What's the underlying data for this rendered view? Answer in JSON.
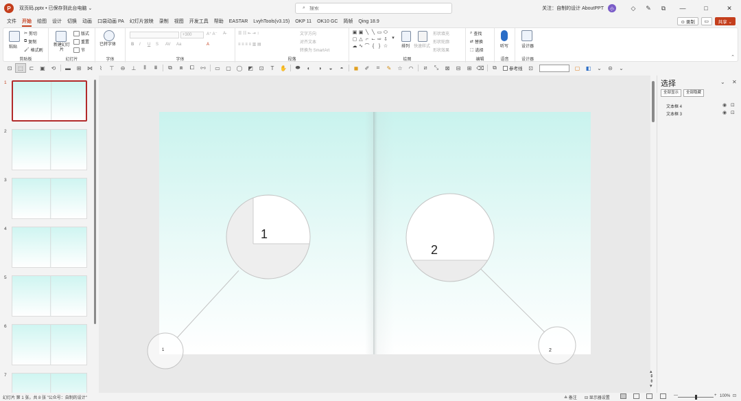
{
  "titlebar": {
    "logo": "P",
    "doc_title": "双页码.pptx • 已保存到此台电脑 ⌄",
    "search_placeholder": "搜索",
    "follow_text": "关注：自制的设计 AboutPPT",
    "avatar": "小",
    "icons": [
      "diamond-icon",
      "pen-icon",
      "restore-icon"
    ],
    "win_minimize": "—",
    "win_maximize": "□",
    "win_close": "✕"
  },
  "menu": {
    "items": [
      "文件",
      "开始",
      "绘图",
      "设计",
      "切换",
      "动画",
      "口袋动画 PA",
      "幻灯片放映",
      "录制",
      "视图",
      "开发工具",
      "帮助",
      "EASTAR",
      "LvyhTools(v3.15)",
      "OKP 11",
      "OK10 GC",
      "简帧",
      "Qing 18.9"
    ],
    "active_index": 1,
    "record_label": "⊙ 录制",
    "comment_label": "▭",
    "share_label": "共享 ⌄"
  },
  "ribbon": {
    "clipboard": {
      "label": "剪贴板",
      "paste": "粘贴",
      "cut": "剪切",
      "copy": "复制",
      "format": "格式刷"
    },
    "slides": {
      "label": "幻灯片",
      "new_slide": "新建幻灯片",
      "layout": "版式",
      "reset": "重置",
      "section": "节"
    },
    "font_group": {
      "label": "字体",
      "convert": "已转字体",
      "font_placeholder": "",
      "size_placeholder": "+300"
    },
    "font": {
      "label": "字体",
      "bold": "B",
      "italic": "I",
      "underline": "U",
      "strike": "S",
      "spacing": "AV",
      "case": "Aa",
      "color": "A"
    },
    "paragraph": {
      "label": "段落",
      "text_direction": "文字方向",
      "align_text": "对齐文本",
      "smartart": "转换为 SmartArt"
    },
    "drawing": {
      "label": "绘图",
      "arrange": "排列",
      "quick_styles": "快速样式",
      "fill": "形状填充",
      "outline": "形状轮廓",
      "effects": "形状效果"
    },
    "editing": {
      "label": "编辑",
      "find": "查找",
      "replace": "替换",
      "select": "选择"
    },
    "voice": {
      "label": "语音",
      "dictate": "听写"
    },
    "designer": {
      "label": "设计器",
      "design": "设计器"
    }
  },
  "toolbar2": {
    "guides_label": "参考线"
  },
  "thumbnails": {
    "numbers": [
      "1",
      "2",
      "3",
      "4",
      "5",
      "6",
      "7"
    ],
    "active_index": 0
  },
  "slide": {
    "magnifiers": [
      {
        "label": "1",
        "small_label": "1"
      },
      {
        "label": "2",
        "small_label": "2"
      }
    ]
  },
  "selection_pane": {
    "title": "选择",
    "show_all": "全部显示",
    "hide_all": "全部隐藏",
    "items": [
      "文本框 4",
      "文本框 3"
    ],
    "eye_icon": "◉",
    "lock_icon": "⊡",
    "collapse_icon": "⌄",
    "close_icon": "✕"
  },
  "statusbar": {
    "slide_info": "幻灯片 第 1 张，共 8 张   \"公众号：自制的设计\"",
    "notes": "≙ 备注",
    "display": "⊟ 显示器设置",
    "zoom": "100%",
    "zoom_fraction": 0.5,
    "minus": "—",
    "plus": "+",
    "fit_icon": "⊡"
  }
}
